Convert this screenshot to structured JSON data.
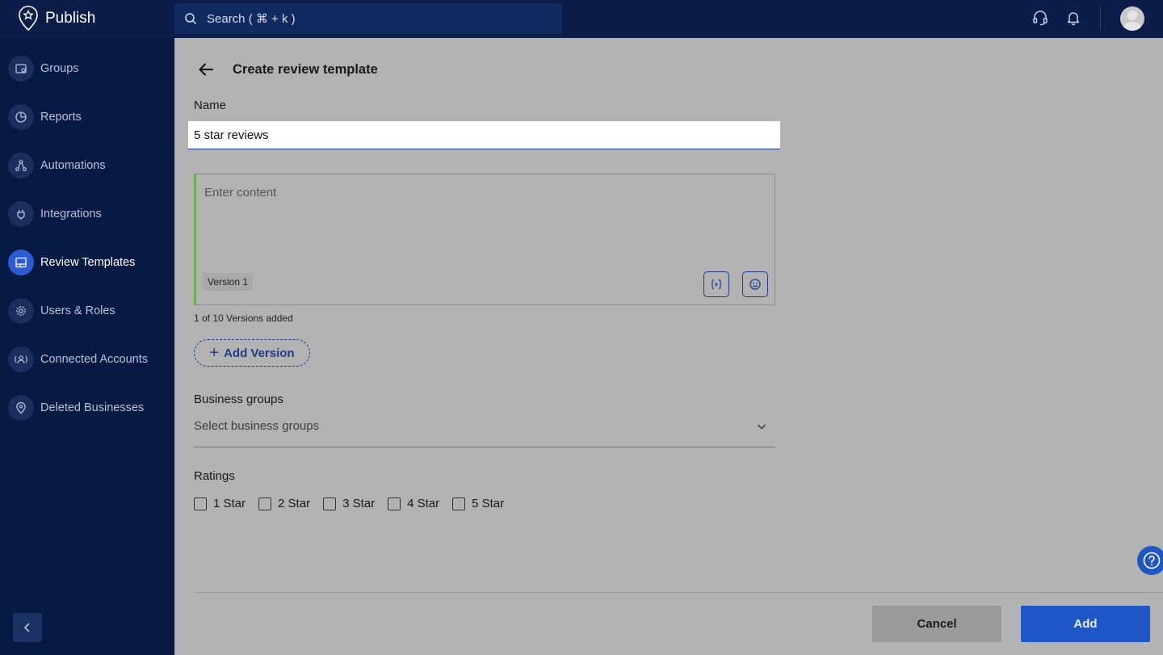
{
  "app": {
    "name": "Publish",
    "logo_icon": "badge-pin-icon"
  },
  "search": {
    "placeholder": "Search ( ⌘ + k )"
  },
  "header_icons": [
    "headset-icon",
    "bell-icon",
    "avatar"
  ],
  "sidebar": {
    "items": [
      {
        "label": "Groups",
        "icon": "groups-icon",
        "active": false
      },
      {
        "label": "Reports",
        "icon": "pie-chart-icon",
        "active": false
      },
      {
        "label": "Automations",
        "icon": "automation-icon",
        "active": false
      },
      {
        "label": "Integrations",
        "icon": "plug-icon",
        "active": false
      },
      {
        "label": "Review Templates",
        "icon": "template-icon",
        "active": true
      },
      {
        "label": "Users & Roles",
        "icon": "gear-icon",
        "active": false
      },
      {
        "label": "Connected Accounts",
        "icon": "connected-accounts-icon",
        "active": false
      },
      {
        "label": "Deleted Businesses",
        "icon": "location-pin-icon",
        "active": false
      }
    ]
  },
  "page": {
    "title": "Create review template",
    "name_label": "Name",
    "name_value": "5 star reviews",
    "content_placeholder": "Enter content",
    "version_tag": "Version 1",
    "versions_count": "1 of 10 Versions added",
    "add_version_label": "Add Version",
    "business_groups_label": "Business groups",
    "business_groups_placeholder": "Select business groups",
    "ratings_label": "Ratings",
    "ratings": [
      "1 Star",
      "2 Star",
      "3 Star",
      "4 Star",
      "5 Star"
    ],
    "cancel_label": "Cancel",
    "add_label": "Add"
  },
  "colors": {
    "topbar": "#0c1d4a",
    "sidebar": "#071a44",
    "accent": "#1f56c6",
    "active_nav": "#2c5bd6",
    "content_border_accent": "#6cb24c"
  }
}
